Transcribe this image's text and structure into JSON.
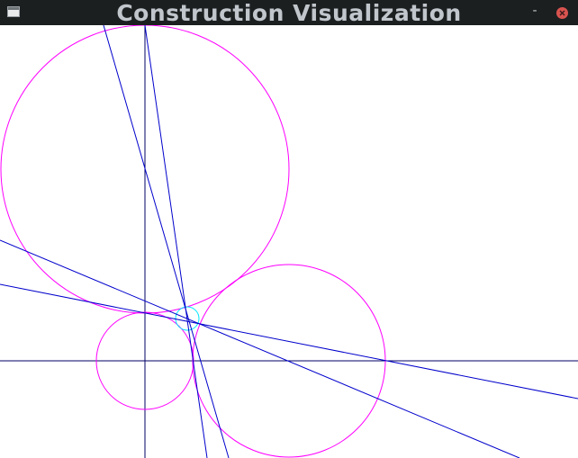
{
  "window": {
    "title": "Construction Visualization",
    "minimize_symbol": "-",
    "icons": {
      "app": "window-icon",
      "minimize": "minimize-icon",
      "close": "close-icon"
    }
  },
  "colors": {
    "titlebar": "#1c1f20",
    "title_text": "#c0c6cc",
    "canvas_bg": "#ffffff",
    "circle_stroke": "#ff00ff",
    "small_circle_stroke": "#00e5ff",
    "line_stroke": "#0000cc",
    "axis_stroke": "#000066",
    "close_button": "#d9534f"
  }
}
